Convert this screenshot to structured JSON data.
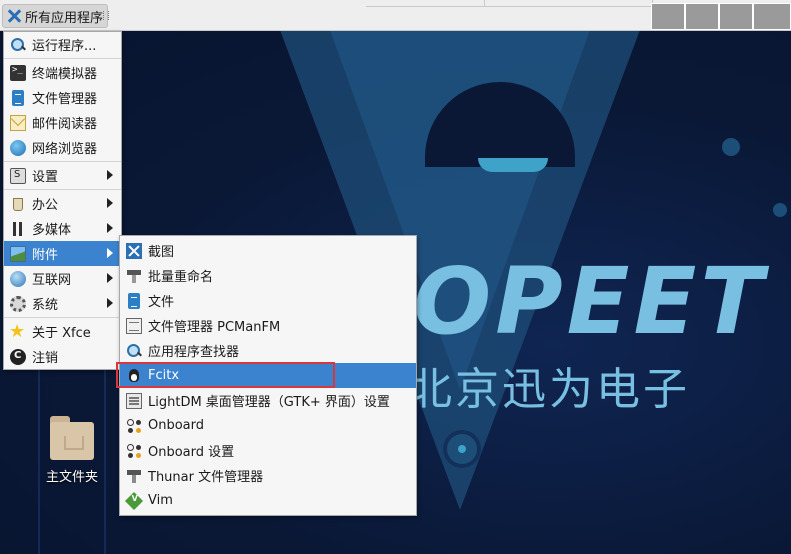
{
  "panel": {
    "applications_button": "所有应用程序"
  },
  "main_menu": {
    "items": [
      {
        "label": "运行程序...",
        "icon": "search-icon"
      },
      {
        "label": "终端模拟器",
        "icon": "terminal-icon"
      },
      {
        "label": "文件管理器",
        "icon": "file-manager-icon"
      },
      {
        "label": "邮件阅读器",
        "icon": "mail-icon"
      },
      {
        "label": "网络浏览器",
        "icon": "web-browser-icon"
      },
      {
        "label": "设置",
        "icon": "settings-icon",
        "submenu": true
      },
      {
        "label": "办公",
        "icon": "office-icon",
        "submenu": true
      },
      {
        "label": "多媒体",
        "icon": "multimedia-icon",
        "submenu": true
      },
      {
        "label": "附件",
        "icon": "accessories-icon",
        "submenu": true,
        "active": true
      },
      {
        "label": "互联网",
        "icon": "internet-icon",
        "submenu": true
      },
      {
        "label": "系统",
        "icon": "system-icon",
        "submenu": true
      },
      {
        "label": "关于 Xfce",
        "icon": "star-icon"
      },
      {
        "label": "注销",
        "icon": "logout-icon"
      }
    ]
  },
  "accessories_menu": {
    "items": [
      {
        "label": "截图",
        "icon": "screenshot-icon"
      },
      {
        "label": "批量重命名",
        "icon": "bulk-rename-icon"
      },
      {
        "label": "文件",
        "icon": "file-icon"
      },
      {
        "label": "文件管理器 PCManFM",
        "icon": "pcmanfm-icon"
      },
      {
        "label": "应用程序查找器",
        "icon": "app-finder-icon"
      },
      {
        "label": "Fcitx",
        "icon": "fcitx-tux-icon",
        "active": true
      },
      {
        "label": "LightDM 桌面管理器（GTK+ 界面）设置",
        "icon": "lightdm-icon"
      },
      {
        "label": "Onboard",
        "icon": "onboard-icon"
      },
      {
        "label": "Onboard 设置",
        "icon": "onboard-settings-icon"
      },
      {
        "label": "Thunar 文件管理器",
        "icon": "thunar-icon"
      },
      {
        "label": "Vim",
        "icon": "vim-icon"
      }
    ]
  },
  "desktop": {
    "wallpaper_text": "OPEET",
    "wallpaper_subtext": "北京迅为电子",
    "home_folder_label": "主文件夹"
  },
  "colors": {
    "accent": "#3b82cf",
    "highlight_border": "#d9363e",
    "wallpaper_bg": "#0a1836",
    "wallpaper_text": "#78bfe1"
  }
}
